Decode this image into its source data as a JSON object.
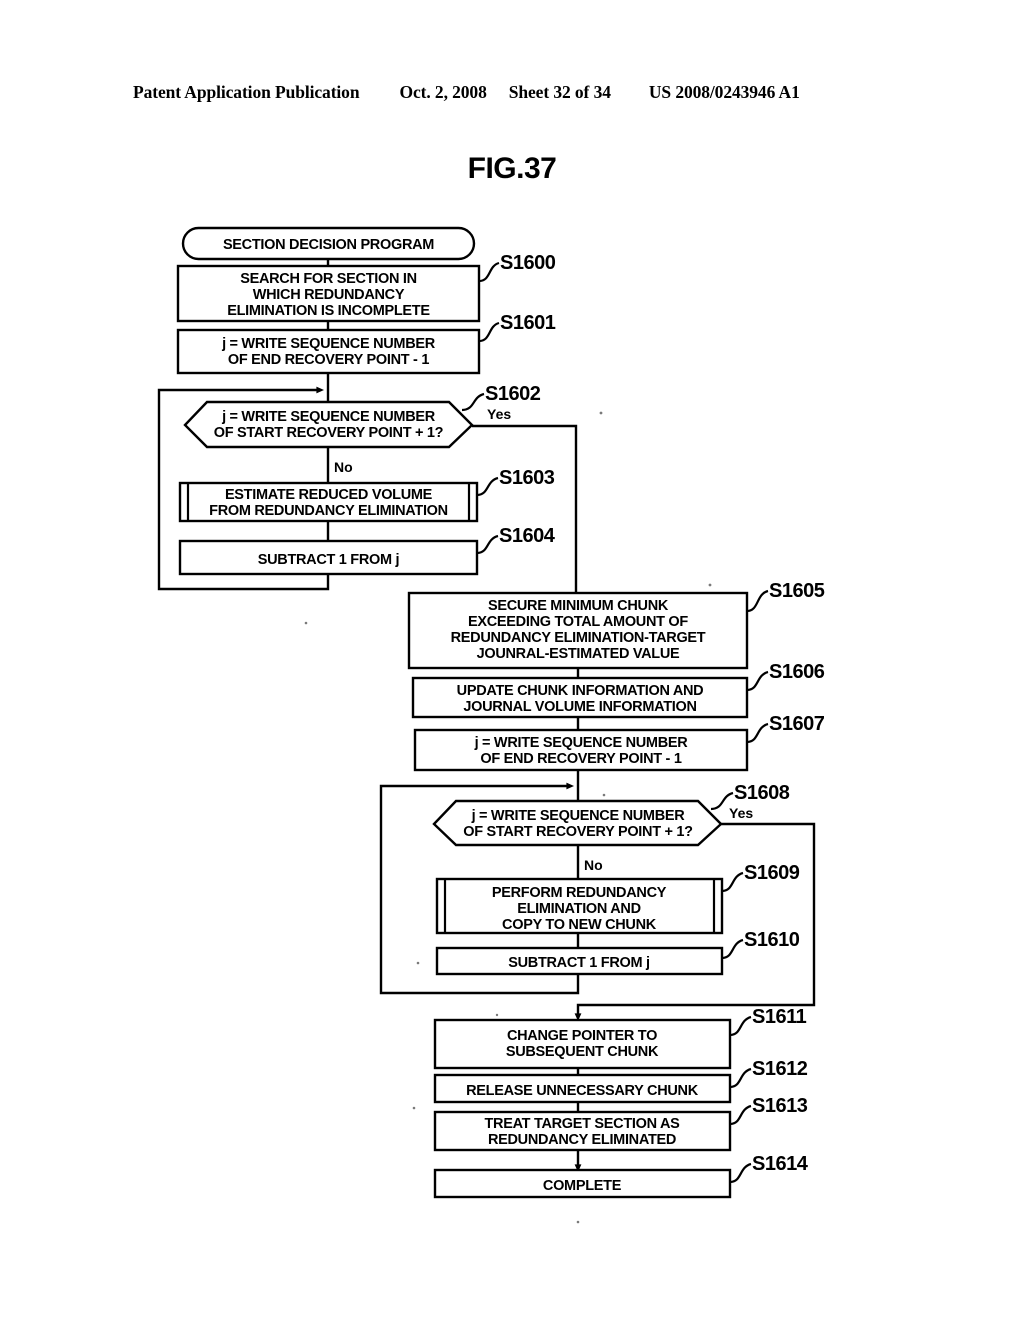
{
  "header": {
    "title": "Patent Application Publication",
    "date": "Oct. 2, 2008",
    "sheet": "Sheet 32 of 34",
    "doc_number": "US 2008/0243946 A1"
  },
  "figure": {
    "title": "FIG.37"
  },
  "diagram": {
    "type": "flowchart",
    "title": "SECTION DECISION PROGRAM",
    "branch_labels": {
      "yes": "Yes",
      "no": "No"
    },
    "nodes": [
      {
        "id": "start",
        "shape": "terminator",
        "step": "",
        "lines": [
          "SECTION DECISION PROGRAM"
        ]
      },
      {
        "id": "s1600",
        "shape": "process",
        "step": "S1600",
        "lines": [
          "SEARCH FOR SECTION IN",
          "WHICH REDUNDANCY",
          "ELIMINATION IS INCOMPLETE"
        ]
      },
      {
        "id": "s1601",
        "shape": "process",
        "step": "S1601",
        "lines": [
          "j = WRITE SEQUENCE NUMBER",
          "OF END RECOVERY POINT - 1"
        ]
      },
      {
        "id": "s1602",
        "shape": "decision",
        "step": "S1602",
        "lines": [
          "j = WRITE SEQUENCE NUMBER",
          "OF START RECOVERY POINT + 1?"
        ]
      },
      {
        "id": "s1603",
        "shape": "predefined",
        "step": "S1603",
        "lines": [
          "ESTIMATE REDUCED VOLUME",
          "FROM REDUNDANCY ELIMINATION"
        ]
      },
      {
        "id": "s1604",
        "shape": "process",
        "step": "S1604",
        "lines": [
          "SUBTRACT 1 FROM j"
        ]
      },
      {
        "id": "s1605",
        "shape": "process",
        "step": "S1605",
        "lines": [
          "SECURE MINIMUM CHUNK",
          "EXCEEDING TOTAL AMOUNT OF",
          "REDUNDANCY ELIMINATION-TARGET",
          "JOUNRAL-ESTIMATED VALUE"
        ]
      },
      {
        "id": "s1606",
        "shape": "process",
        "step": "S1606",
        "lines": [
          "UPDATE CHUNK INFORMATION AND",
          "JOURNAL VOLUME INFORMATION"
        ]
      },
      {
        "id": "s1607",
        "shape": "process",
        "step": "S1607",
        "lines": [
          "j = WRITE SEQUENCE NUMBER",
          "OF END RECOVERY POINT - 1"
        ]
      },
      {
        "id": "s1608",
        "shape": "decision",
        "step": "S1608",
        "lines": [
          "j = WRITE SEQUENCE NUMBER",
          "OF START RECOVERY POINT + 1?"
        ]
      },
      {
        "id": "s1609",
        "shape": "predefined",
        "step": "S1609",
        "lines": [
          "PERFORM REDUNDANCY",
          "ELIMINATION AND",
          "COPY TO NEW CHUNK"
        ]
      },
      {
        "id": "s1610",
        "shape": "process",
        "step": "S1610",
        "lines": [
          "SUBTRACT 1 FROM j"
        ]
      },
      {
        "id": "s1611",
        "shape": "process",
        "step": "S1611",
        "lines": [
          "CHANGE POINTER TO",
          "SUBSEQUENT CHUNK"
        ]
      },
      {
        "id": "s1612",
        "shape": "process",
        "step": "S1612",
        "lines": [
          "RELEASE UNNECESSARY CHUNK"
        ]
      },
      {
        "id": "s1613",
        "shape": "process",
        "step": "S1613",
        "lines": [
          "TREAT TARGET SECTION AS",
          "REDUNDANCY ELIMINATED"
        ]
      },
      {
        "id": "s1614",
        "shape": "process",
        "step": "S1614",
        "lines": [
          "COMPLETE"
        ]
      }
    ]
  }
}
